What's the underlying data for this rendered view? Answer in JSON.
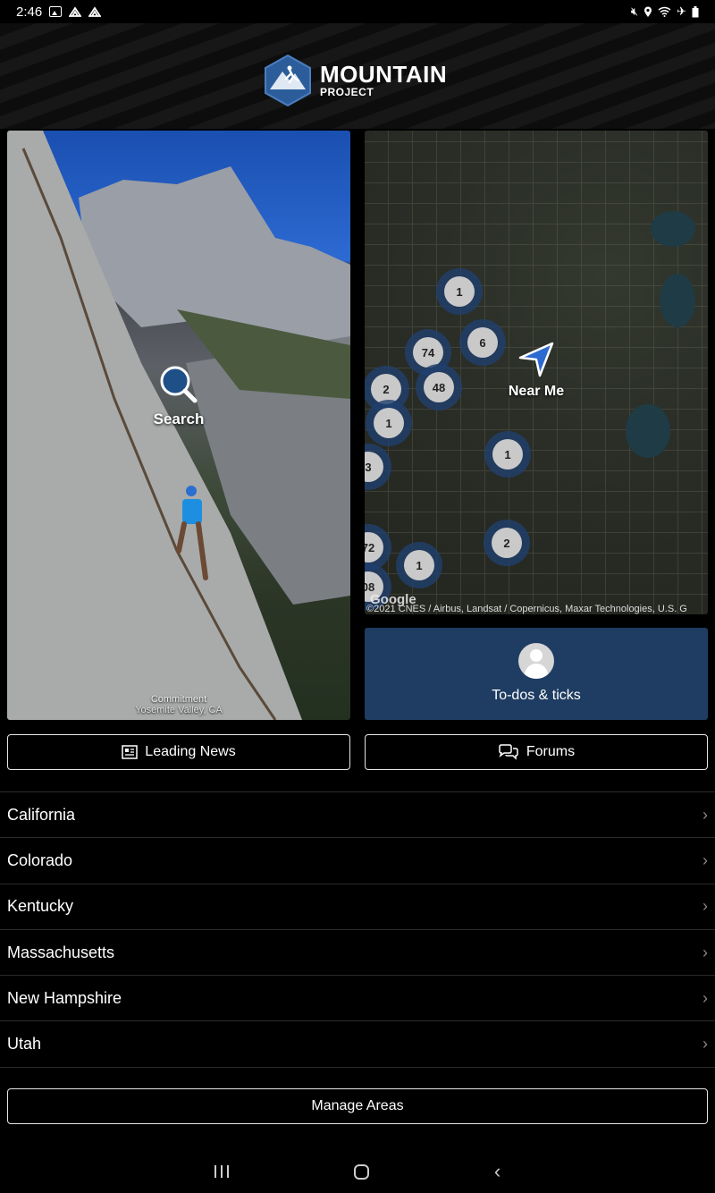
{
  "status_bar": {
    "time": "2:46"
  },
  "header": {
    "brand_line1": "MOUNTAIN",
    "brand_line2": "PROJECT"
  },
  "search_card": {
    "label": "Search",
    "caption_title": "Commitment",
    "caption_location": "Yosemite Valley, CA"
  },
  "map_card": {
    "label": "Near Me",
    "google": "Google",
    "attribution": "©2021 CNES / Airbus, Landsat / Copernicus, Maxar Technologies, U.S. G",
    "clusters": [
      "1",
      "74",
      "6",
      "48",
      "2",
      "1",
      "1",
      "3",
      "2",
      "1",
      "72",
      "08"
    ]
  },
  "todo_card": {
    "label": "To-dos & ticks"
  },
  "buttons": {
    "news": "Leading News",
    "forums": "Forums",
    "manage": "Manage Areas"
  },
  "areas": [
    {
      "name": "California"
    },
    {
      "name": "Colorado"
    },
    {
      "name": "Kentucky"
    },
    {
      "name": "Massachusetts"
    },
    {
      "name": "New Hampshire"
    },
    {
      "name": "Utah"
    }
  ],
  "colors": {
    "brand_blue": "#2c5d9a",
    "todo_bg": "#1f3d62",
    "cluster": "#20406e"
  }
}
